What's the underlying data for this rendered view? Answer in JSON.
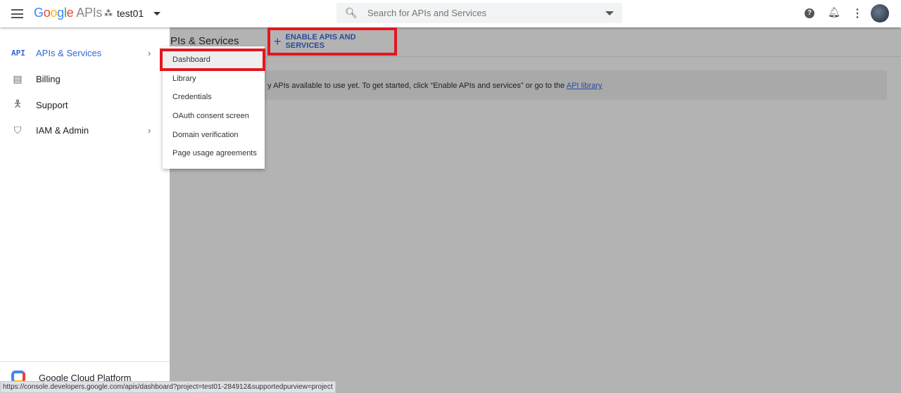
{
  "header": {
    "logo_google": "Google",
    "logo_apis": "APIs",
    "project": "test01",
    "search_placeholder": "Search for APIs and Services"
  },
  "sidebar": {
    "items": [
      {
        "label": "APIs & Services",
        "icon": "API",
        "active": true,
        "has_submenu": true
      },
      {
        "label": "Billing",
        "icon": "billing-icon"
      },
      {
        "label": "Support",
        "icon": "support-icon"
      },
      {
        "label": "IAM & Admin",
        "icon": "shield-icon",
        "has_submenu": true
      }
    ],
    "footer": "Google Cloud Platform"
  },
  "submenu": {
    "items": [
      "Dashboard",
      "Library",
      "Credentials",
      "OAuth consent screen",
      "Domain verification",
      "Page usage agreements"
    ],
    "selected": "Dashboard"
  },
  "main": {
    "title": "PIs & Services",
    "enable_button": "ENABLE APIS AND SERVICES",
    "banner_text": "y APIs available to use yet. To get started, click “Enable APIs and services” or go to the ",
    "banner_link": "API library"
  },
  "status_url": "https://console.developers.google.com/apis/dashboard?project=test01-284912&supportedpurview=project",
  "colors": {
    "accent": "#3367d6",
    "highlight": "#e3161e",
    "overlay": "#b3b3b3"
  }
}
